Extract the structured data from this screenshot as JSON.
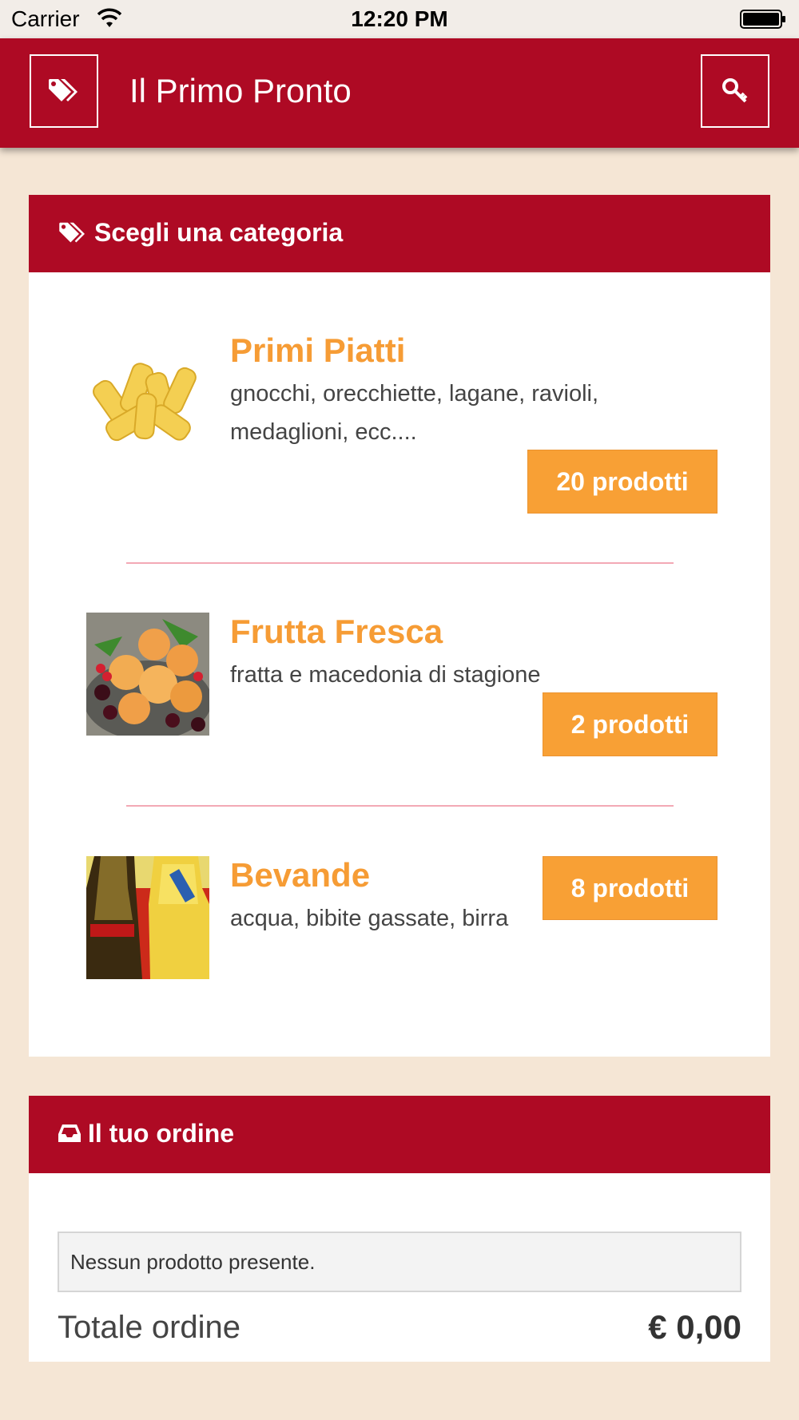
{
  "status_bar": {
    "carrier": "Carrier",
    "time": "12:20 PM"
  },
  "navbar": {
    "title": "Il Primo Pronto",
    "left_icon": "tags-icon",
    "right_icon": "key-icon"
  },
  "categories_panel": {
    "header": "Scegli una categoria",
    "header_icon": "tags-icon",
    "items": [
      {
        "name": "Primi Piatti",
        "description": "gnocchi, orecchiette, lagane, ravioli, medaglioni, ecc....",
        "count_label": "20 prodotti"
      },
      {
        "name": "Frutta Fresca",
        "description": "fratta e macedonia di stagione",
        "count_label": "2 prodotti"
      },
      {
        "name": "Bevande",
        "description": "acqua, bibite gassate, birra",
        "count_label": "8 prodotti"
      }
    ]
  },
  "order_panel": {
    "header": "Il tuo ordine",
    "header_icon": "inbox-icon",
    "empty_message": "Nessun prodotto presente.",
    "total_label": "Totale ordine",
    "total_value": "€ 0,00"
  },
  "colors": {
    "brand_red": "#ae0a24",
    "accent_orange": "#f8a035",
    "background": "#f5e6d5"
  }
}
